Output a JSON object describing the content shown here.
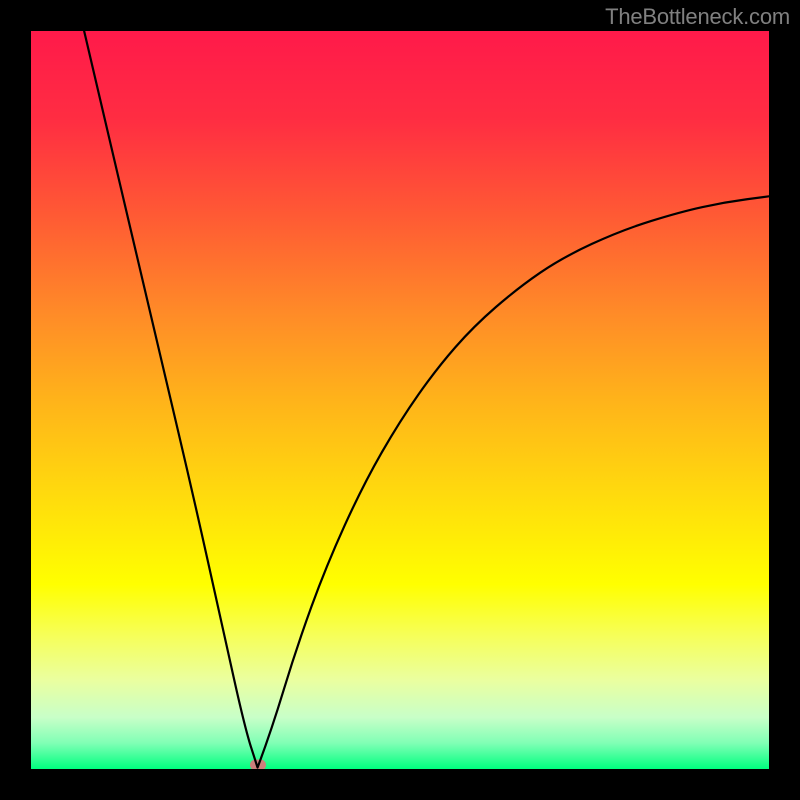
{
  "watermark": "TheBottleneck.com",
  "chart_data": {
    "type": "line",
    "title": "",
    "xlabel": "",
    "ylabel": "",
    "xlim": [
      0,
      1
    ],
    "ylim": [
      0,
      1
    ],
    "grid": false,
    "background": {
      "type": "vertical-gradient",
      "stops": [
        {
          "pos": 0.0,
          "color": "#ff1a4a"
        },
        {
          "pos": 0.12,
          "color": "#ff2d42"
        },
        {
          "pos": 0.25,
          "color": "#ff5a34"
        },
        {
          "pos": 0.38,
          "color": "#ff8a28"
        },
        {
          "pos": 0.5,
          "color": "#ffb31a"
        },
        {
          "pos": 0.62,
          "color": "#ffd80e"
        },
        {
          "pos": 0.75,
          "color": "#ffff00"
        },
        {
          "pos": 0.82,
          "color": "#f6ff5a"
        },
        {
          "pos": 0.88,
          "color": "#eaffa0"
        },
        {
          "pos": 0.93,
          "color": "#c8ffc8"
        },
        {
          "pos": 0.965,
          "color": "#80ffb5"
        },
        {
          "pos": 1.0,
          "color": "#00ff7f"
        }
      ]
    },
    "series": [
      {
        "name": "bottleneck-curve",
        "color": "#000000",
        "approx_min_x": 0.307,
        "left_endpoint": {
          "x": 0.072,
          "y": 1.0
        },
        "right_endpoint": {
          "x": 1.0,
          "y": 0.776
        },
        "x": [
          0.072,
          0.1,
          0.14,
          0.18,
          0.22,
          0.26,
          0.29,
          0.307,
          0.325,
          0.36,
          0.4,
          0.45,
          0.5,
          0.55,
          0.6,
          0.66,
          0.72,
          0.8,
          0.88,
          0.94,
          1.0
        ],
        "y": [
          1.0,
          0.88,
          0.71,
          0.54,
          0.37,
          0.19,
          0.055,
          0.002,
          0.05,
          0.165,
          0.275,
          0.385,
          0.472,
          0.543,
          0.6,
          0.652,
          0.693,
          0.73,
          0.755,
          0.768,
          0.776
        ]
      }
    ],
    "annotations": [
      {
        "name": "min-marker",
        "shape": "rounded-rect",
        "color": "#cd7f7b",
        "x": 0.307,
        "y": 0.005
      }
    ]
  }
}
